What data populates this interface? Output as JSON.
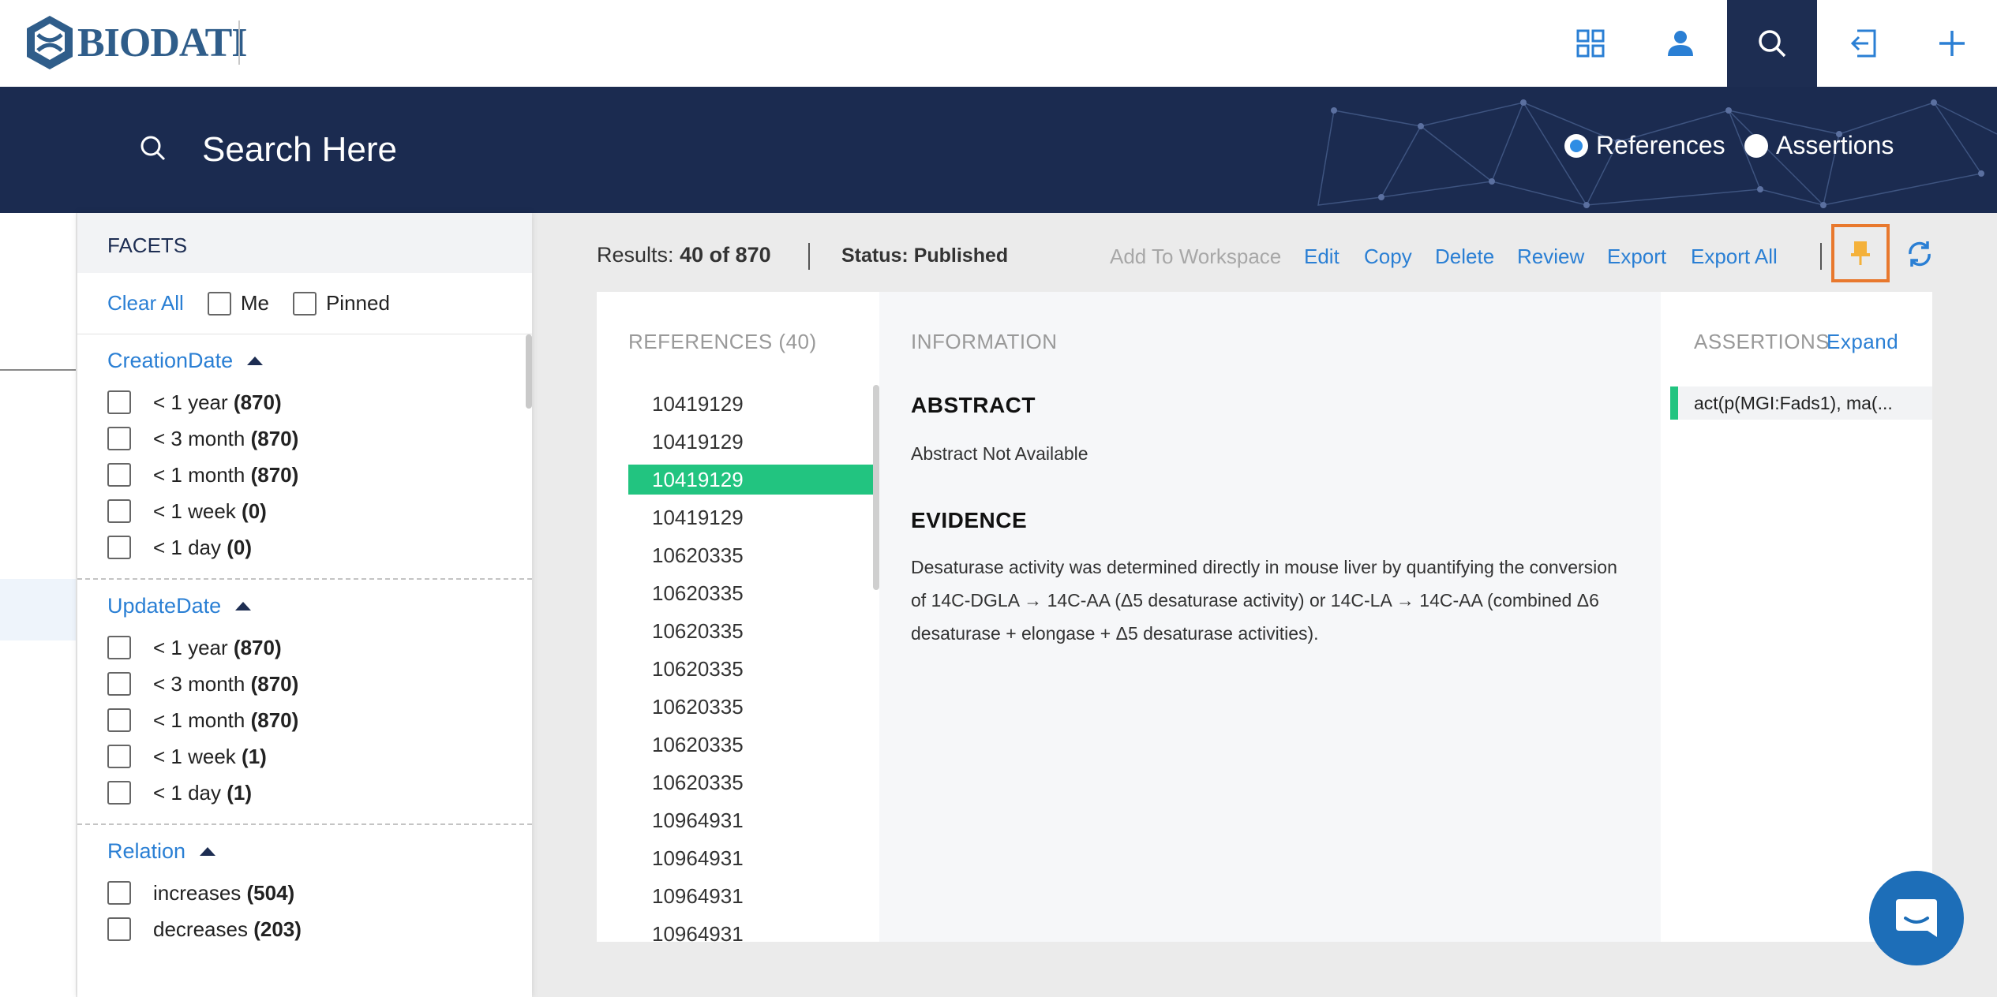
{
  "brand": {
    "name": "BIODATI"
  },
  "search": {
    "placeholder": "Search Here",
    "mode_options": [
      "References",
      "Assertions"
    ],
    "selected_mode": "References"
  },
  "facets": {
    "title": "FACETS",
    "clear_all": "Clear All",
    "filters": {
      "me": "Me",
      "pinned": "Pinned"
    },
    "sections": [
      {
        "title": "CreationDate",
        "rows": [
          {
            "label": "< 1 year",
            "count": "(870)"
          },
          {
            "label": "< 3 month",
            "count": "(870)"
          },
          {
            "label": "< 1 month",
            "count": "(870)"
          },
          {
            "label": "< 1 week",
            "count": "(0)"
          },
          {
            "label": "< 1 day",
            "count": "(0)"
          }
        ]
      },
      {
        "title": "UpdateDate",
        "rows": [
          {
            "label": "< 1 year",
            "count": "(870)"
          },
          {
            "label": "< 3 month",
            "count": "(870)"
          },
          {
            "label": "< 1 month",
            "count": "(870)"
          },
          {
            "label": "< 1 week",
            "count": "(1)"
          },
          {
            "label": "< 1 day",
            "count": "(1)"
          }
        ]
      },
      {
        "title": "Relation",
        "rows": [
          {
            "label": "increases",
            "count": "(504)"
          },
          {
            "label": "decreases",
            "count": "(203)"
          }
        ]
      }
    ]
  },
  "toolbar": {
    "results_label": "Results:",
    "results_value": "40 of 870",
    "status_label": "Status:",
    "status_value": "Published",
    "actions": [
      "Add To Workspace",
      "Edit",
      "Copy",
      "Delete",
      "Review",
      "Export",
      "Export All"
    ]
  },
  "references": {
    "header": "REFERENCES (40)",
    "items": [
      "10419129",
      "10419129",
      "10419129",
      "10419129",
      "10620335",
      "10620335",
      "10620335",
      "10620335",
      "10620335",
      "10620335",
      "10620335",
      "10964931",
      "10964931",
      "10964931",
      "10964931"
    ],
    "selected_index": 2
  },
  "information": {
    "header": "INFORMATION",
    "abstract_title": "ABSTRACT",
    "abstract_text": "Abstract Not Available",
    "evidence_title": "EVIDENCE",
    "evidence_text": "Desaturase activity was determined directly in mouse liver by quantifying the conversion of 14C-DGLA → 14C-AA (Δ5 desaturase activity) or 14C-LA → 14C-AA (combined Δ6 desaturase + elongase + Δ5 desaturase activities)."
  },
  "assertions": {
    "header": "ASSERTIONS",
    "expand": "Expand",
    "items": [
      "act(p(MGI:Fads1), ma(..."
    ]
  },
  "colors": {
    "navy": "#1b2b50",
    "accent": "#2a7fd4",
    "green": "#22c480",
    "pin_border": "#e8782d",
    "pin": "#f4b13a"
  }
}
